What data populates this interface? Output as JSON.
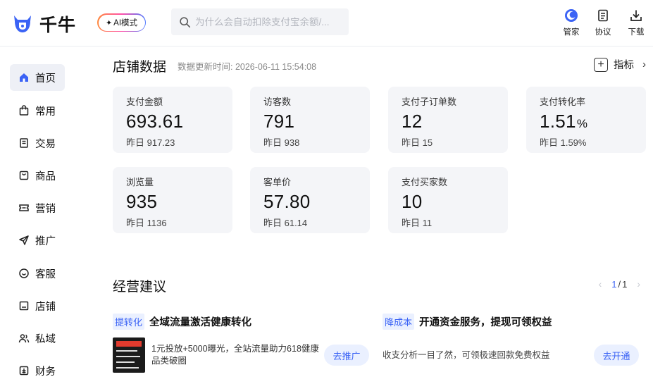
{
  "header": {
    "logo_text": "千牛",
    "ai_mode": "AI模式",
    "search_placeholder": "为什么会自动扣除支付宝余额/...",
    "actions": [
      {
        "label": "管家",
        "icon": "butler-moon-icon"
      },
      {
        "label": "协议",
        "icon": "document-icon"
      },
      {
        "label": "下载",
        "icon": "download-icon"
      }
    ]
  },
  "sidebar": {
    "items": [
      {
        "label": "首页",
        "icon": "home-icon",
        "active": true
      },
      {
        "label": "常用",
        "icon": "shopping-bag-icon"
      },
      {
        "label": "交易",
        "icon": "receipt-icon"
      },
      {
        "label": "商品",
        "icon": "product-box-icon"
      },
      {
        "label": "营销",
        "icon": "ticket-icon"
      },
      {
        "label": "推广",
        "icon": "send-icon"
      },
      {
        "label": "客服",
        "icon": "chat-smile-icon"
      },
      {
        "label": "店铺",
        "icon": "store-icon"
      },
      {
        "label": "私域",
        "icon": "users-icon"
      },
      {
        "label": "财务",
        "icon": "finance-icon"
      }
    ]
  },
  "store_data": {
    "title": "店铺数据",
    "update_time": "数据更新时间: 2026-06-11 15:54:08",
    "indicator_label": "指标",
    "metrics": [
      {
        "label": "支付金额",
        "value": "693.61",
        "unit": "",
        "yesterday": "昨日 917.23"
      },
      {
        "label": "访客数",
        "value": "791",
        "unit": "",
        "yesterday": "昨日 938"
      },
      {
        "label": "支付子订单数",
        "value": "12",
        "unit": "",
        "yesterday": "昨日 15"
      },
      {
        "label": "支付转化率",
        "value": "1.51",
        "unit": "%",
        "yesterday": "昨日 1.59%"
      },
      {
        "label": "浏览量",
        "value": "935",
        "unit": "",
        "yesterday": "昨日 1136"
      },
      {
        "label": "客单价",
        "value": "57.80",
        "unit": "",
        "yesterday": "昨日 61.14"
      },
      {
        "label": "支付买家数",
        "value": "10",
        "unit": "",
        "yesterday": "昨日 11"
      }
    ]
  },
  "suggestions": {
    "title": "经营建议",
    "pager": {
      "current": "1",
      "separator": "/",
      "total": "1"
    },
    "items": [
      {
        "tag": "提转化",
        "title": "全域流量激活健康转化",
        "desc": "1元投放+5000曝光，全站流量助力618健康品类破圈",
        "action": "去推广"
      },
      {
        "tag": "降成本",
        "title": "开通资金服务，提现可领权益",
        "desc": "收支分析一目了然，可领极速回款免费权益",
        "action": "去开通"
      }
    ]
  },
  "colors": {
    "accent": "#3b63f5",
    "card_bg": "#f4f5f8",
    "tag_bg": "#eaf0ff"
  }
}
